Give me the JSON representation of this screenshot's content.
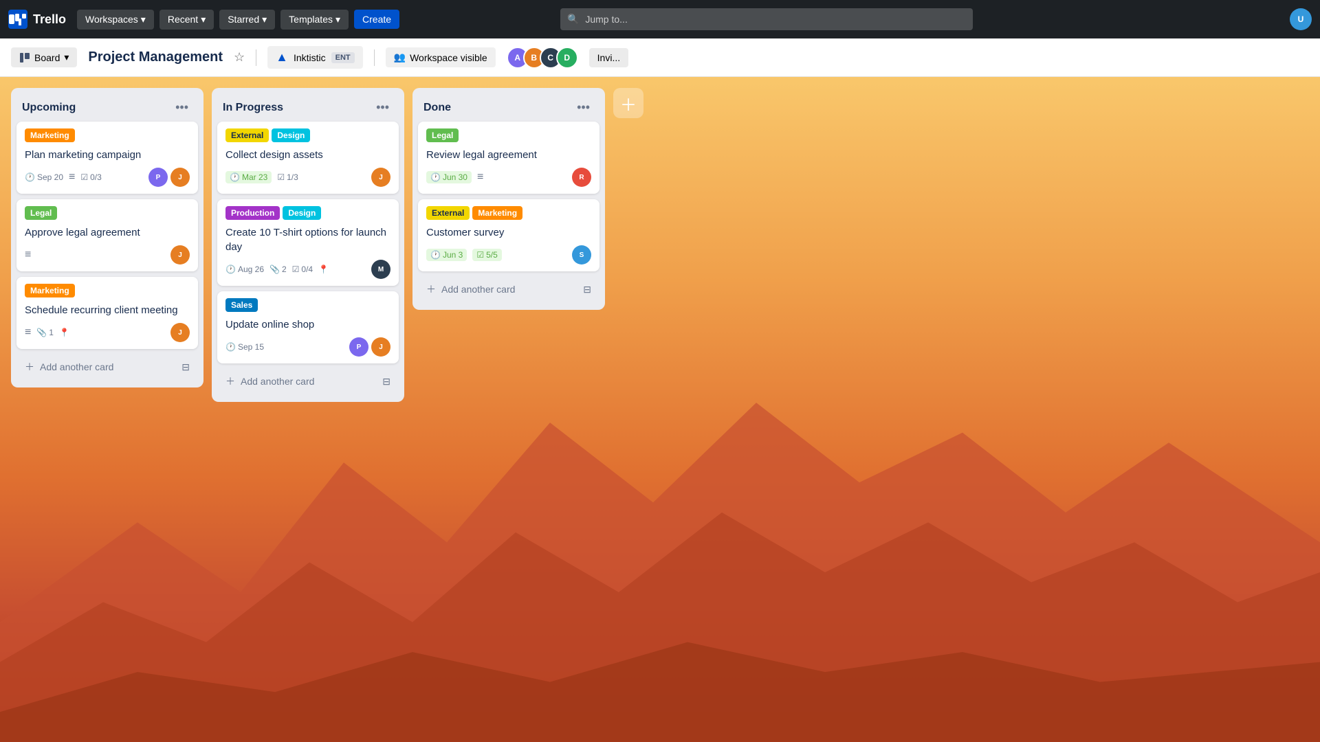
{
  "app": {
    "name": "Trello",
    "logo_text": "Trello"
  },
  "nav": {
    "workspaces_label": "Workspaces",
    "search_placeholder": "Jump to...",
    "recent_label": "Recent",
    "starred_label": "Starred",
    "templates_label": "Templates",
    "create_label": "Create"
  },
  "board_header": {
    "view_label": "Board",
    "title": "Project Management",
    "workspace_name": "Inktistic",
    "workspace_badge": "ENT",
    "visibility_label": "Workspace visible",
    "invite_label": "Invi..."
  },
  "columns": [
    {
      "id": "upcoming",
      "title": "Upcoming",
      "cards": [
        {
          "id": "card-1",
          "labels": [
            {
              "text": "Marketing",
              "color": "orange"
            }
          ],
          "title": "Plan marketing campaign",
          "meta": [
            {
              "type": "date",
              "value": "Sep 20"
            },
            {
              "type": "description"
            },
            {
              "type": "checklist",
              "value": "0/3"
            }
          ],
          "avatars": [
            "av1",
            "av2"
          ]
        },
        {
          "id": "card-2",
          "labels": [
            {
              "text": "Legal",
              "color": "green"
            }
          ],
          "title": "Approve legal agreement",
          "meta": [
            {
              "type": "description"
            }
          ],
          "avatars": [
            "av2"
          ]
        },
        {
          "id": "card-3",
          "labels": [
            {
              "text": "Marketing",
              "color": "orange"
            }
          ],
          "title": "Schedule recurring client meeting",
          "meta": [
            {
              "type": "description"
            },
            {
              "type": "attachment",
              "value": "1"
            },
            {
              "type": "location"
            }
          ],
          "avatars": [
            "av2"
          ]
        }
      ],
      "add_label": "Add another card"
    },
    {
      "id": "in-progress",
      "title": "In Progress",
      "cards": [
        {
          "id": "card-4",
          "labels": [
            {
              "text": "External",
              "color": "yellow"
            },
            {
              "text": "Design",
              "color": "teal"
            }
          ],
          "title": "Collect design assets",
          "meta": [
            {
              "type": "date",
              "value": "Mar 23",
              "green": true
            },
            {
              "type": "checklist",
              "value": "1/3"
            }
          ],
          "avatars": [
            "av2"
          ]
        },
        {
          "id": "card-5",
          "labels": [
            {
              "text": "Production",
              "color": "purple"
            },
            {
              "text": "Design",
              "color": "teal"
            }
          ],
          "title": "Create 10 T-shirt options for launch day",
          "meta": [
            {
              "type": "date",
              "value": "Aug 26"
            },
            {
              "type": "attachment",
              "value": "2"
            },
            {
              "type": "checklist",
              "value": "0/4"
            },
            {
              "type": "location"
            }
          ],
          "avatars": [
            "av3"
          ]
        },
        {
          "id": "card-6",
          "labels": [
            {
              "text": "Sales",
              "color": "blue"
            }
          ],
          "title": "Update online shop",
          "meta": [
            {
              "type": "date",
              "value": "Sep 15"
            }
          ],
          "avatars": [
            "av1",
            "av2"
          ]
        }
      ],
      "add_label": "Add another card"
    },
    {
      "id": "done",
      "title": "Done",
      "cards": [
        {
          "id": "card-7",
          "labels": [
            {
              "text": "Legal",
              "color": "green"
            }
          ],
          "title": "Review legal agreement",
          "meta": [
            {
              "type": "date",
              "value": "Jun 30",
              "green": true
            },
            {
              "type": "description"
            }
          ],
          "avatars": [
            "av4"
          ]
        },
        {
          "id": "card-8",
          "labels": [
            {
              "text": "External",
              "color": "yellow"
            },
            {
              "text": "Marketing",
              "color": "orange"
            }
          ],
          "title": "Customer survey",
          "meta": [
            {
              "type": "date",
              "value": "Jun 3",
              "green": true
            },
            {
              "type": "checklist",
              "value": "5/5",
              "green": true
            }
          ],
          "avatars": [
            "av5"
          ]
        }
      ],
      "add_label": "Add another card"
    }
  ],
  "members": [
    {
      "initials": "A",
      "color": "#8777d9"
    },
    {
      "initials": "B",
      "color": "#e67e22"
    },
    {
      "initials": "C",
      "color": "#2ecc71"
    },
    {
      "initials": "D",
      "color": "#e74c3c"
    }
  ]
}
